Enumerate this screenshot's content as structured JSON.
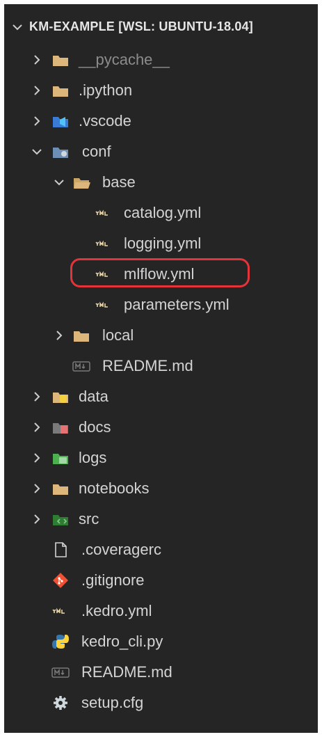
{
  "explorer": {
    "workspace_title": "KM-EXAMPLE [WSL: UBUNTU-18.04]",
    "tree": [
      {
        "label": "__pycache__",
        "kind": "folder",
        "expanded": false,
        "icon": "folder-icon"
      },
      {
        "label": ".ipython",
        "kind": "folder",
        "expanded": false,
        "icon": "folder-icon"
      },
      {
        "label": ".vscode",
        "kind": "folder",
        "expanded": false,
        "icon": "vscode-folder-icon"
      },
      {
        "label": "conf",
        "kind": "folder",
        "expanded": true,
        "icon": "config-folder-icon"
      },
      {
        "label": "base",
        "kind": "folder",
        "expanded": true,
        "icon": "folder-open-icon"
      },
      {
        "label": "catalog.yml",
        "kind": "file",
        "icon": "yaml-icon"
      },
      {
        "label": "logging.yml",
        "kind": "file",
        "icon": "yaml-icon"
      },
      {
        "label": "mlflow.yml",
        "kind": "file",
        "icon": "yaml-icon",
        "highlighted": true
      },
      {
        "label": "parameters.yml",
        "kind": "file",
        "icon": "yaml-icon"
      },
      {
        "label": "local",
        "kind": "folder",
        "expanded": false,
        "icon": "folder-icon"
      },
      {
        "label": "README.md",
        "kind": "file",
        "icon": "markdown-icon"
      },
      {
        "label": "data",
        "kind": "folder",
        "expanded": false,
        "icon": "database-folder-icon"
      },
      {
        "label": "docs",
        "kind": "folder",
        "expanded": false,
        "icon": "docs-folder-icon"
      },
      {
        "label": "logs",
        "kind": "folder",
        "expanded": false,
        "icon": "logs-folder-icon"
      },
      {
        "label": "notebooks",
        "kind": "folder",
        "expanded": false,
        "icon": "folder-icon"
      },
      {
        "label": "src",
        "kind": "folder",
        "expanded": false,
        "icon": "src-folder-icon"
      },
      {
        "label": ".coveragerc",
        "kind": "file",
        "icon": "file-icon"
      },
      {
        "label": ".gitignore",
        "kind": "file",
        "icon": "git-icon"
      },
      {
        "label": ".kedro.yml",
        "kind": "file",
        "icon": "yaml-icon"
      },
      {
        "label": "kedro_cli.py",
        "kind": "file",
        "icon": "python-icon"
      },
      {
        "label": "README.md",
        "kind": "file",
        "icon": "markdown-icon"
      },
      {
        "label": "setup.cfg",
        "kind": "file",
        "icon": "gear-icon"
      }
    ]
  },
  "colors": {
    "background": "#252526",
    "text": "#d4d4d4",
    "folder": "#dcb67a",
    "highlight_ring": "#e3343a"
  }
}
